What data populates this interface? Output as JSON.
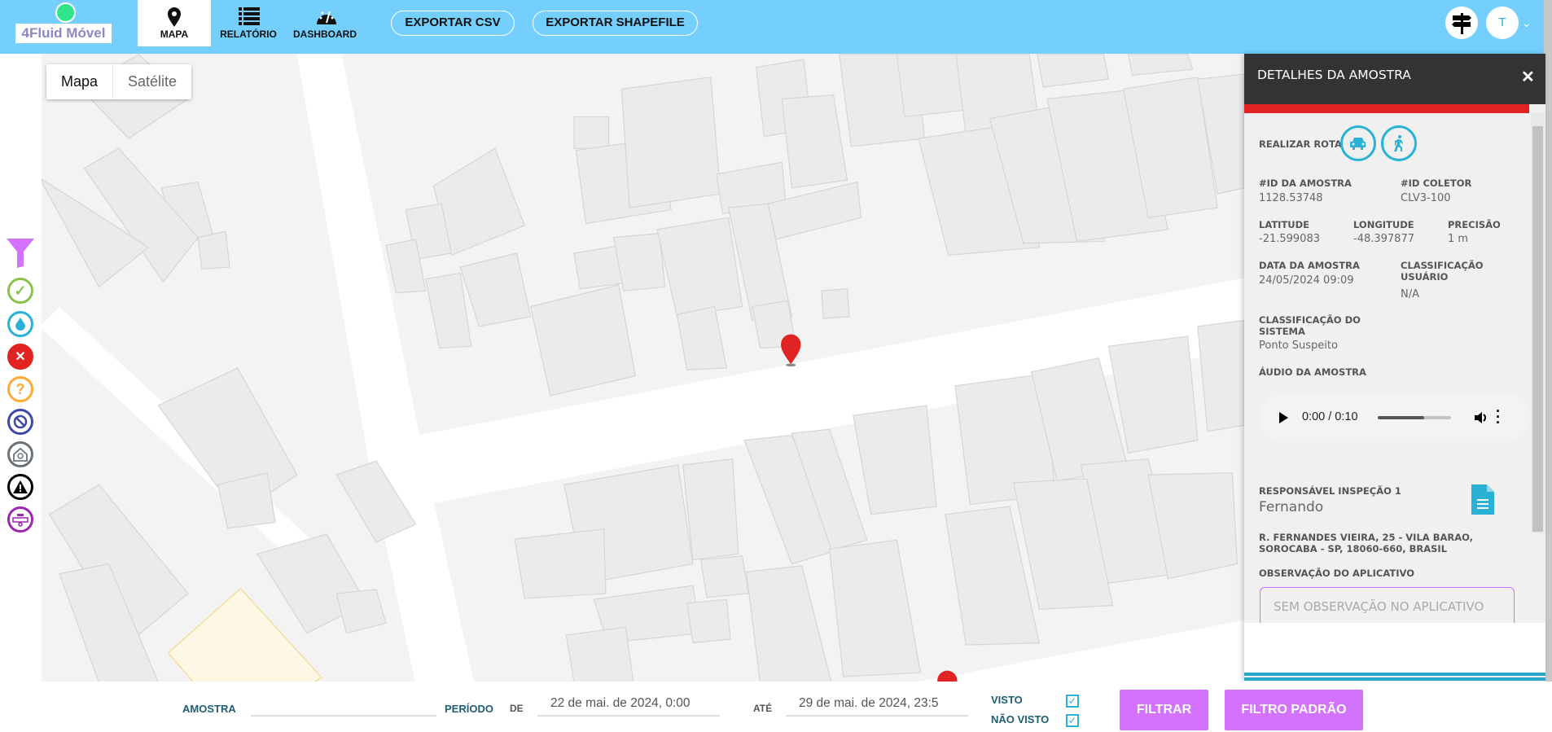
{
  "header": {
    "logo": "4Fluid Móvel",
    "tabs": [
      {
        "label": "MAPA",
        "icon": "map-pin-icon",
        "active": true
      },
      {
        "label": "RELATÓRIO",
        "icon": "list-icon"
      },
      {
        "label": "DASHBOARD",
        "icon": "gauge-icon"
      }
    ],
    "export_csv": "EXPORTAR CSV",
    "export_shapefile": "EXPORTAR SHAPEFILE",
    "avatar_initial": "T",
    "colors": {
      "bar": "#74cffd"
    }
  },
  "map": {
    "type_options": [
      "Mapa",
      "Satélite"
    ],
    "selected": "Mapa"
  },
  "sidebar": {
    "icons": [
      "filter-icon",
      "check-icon",
      "water-drop-icon",
      "error-x-icon",
      "question-icon",
      "blocked-icon",
      "house-icon",
      "warning-icon",
      "valve-icon"
    ]
  },
  "panel": {
    "title": "DETALHES DA AMOSTRA",
    "route_label": "REALIZAR ROTA",
    "id_amostra": {
      "label": "#ID DA AMOSTRA",
      "value": "1128.53748"
    },
    "id_coletor": {
      "label": "#ID COLETOR",
      "value": "CLV3-100"
    },
    "latitude": {
      "label": "LATITUDE",
      "value": "-21.599083"
    },
    "longitude": {
      "label": "LONGITUDE",
      "value": "-48.397877"
    },
    "precisao": {
      "label": "PRECISÃO",
      "value": "1 m"
    },
    "data": {
      "label": "DATA DA AMOSTRA",
      "value": "24/05/2024 09:09"
    },
    "class_usuario": {
      "label1": "CLASSIFICAÇÃO",
      "label2": "USUÁRIO",
      "value": "N/A"
    },
    "class_sistema": {
      "label1": "CLASSIFICAÇÃO DO",
      "label2": "SISTEMA",
      "value": "Ponto Suspeito"
    },
    "audio": {
      "label": "ÁUDIO DA AMOSTRA",
      "time": "0:00 / 0:10",
      "volume_fraction": 0.63
    },
    "responsavel": {
      "label": "RESPONSÁVEL INSPEÇÃO 1",
      "value": "Fernando"
    },
    "address1": "R. FERNANDES VIEIRA, 25 - VILA BARAO,",
    "address2": "SOROCABA - SP, 18060-660, BRASIL",
    "obs": {
      "label": "OBSERVAÇÃO DO APLICATIVO",
      "placeholder": "SEM OBSERVAÇÃO NO APLICATIVO"
    }
  },
  "filter": {
    "amostra_label": "AMOSTRA",
    "amostra_value": "",
    "periodo_label": "PERÍODO",
    "de_label": "DE",
    "de_value": "22 de mai. de 2024, 0:00",
    "ate_label": "ATÉ",
    "ate_value": "29 de mai. de 2024, 23:5",
    "visto_label": "VISTO",
    "nao_visto_label": "NÃO VISTO",
    "visto_checked": true,
    "nao_visto_checked": true,
    "filtrar": "FILTRAR",
    "filtro_padrao": "FILTRO PADRÃO"
  }
}
